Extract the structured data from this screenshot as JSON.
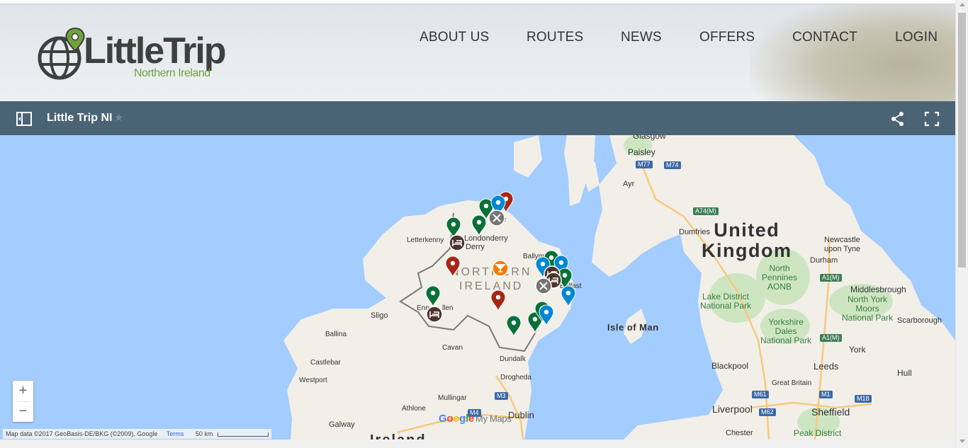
{
  "brand": {
    "name": "LittleTrip",
    "subtitle": "Northern Ireland"
  },
  "nav": {
    "items": [
      {
        "label": "ABOUT US"
      },
      {
        "label": "ROUTES"
      },
      {
        "label": "NEWS"
      },
      {
        "label": "OFFERS"
      },
      {
        "label": "CONTACT"
      },
      {
        "label": "LOGIN"
      }
    ]
  },
  "map_header": {
    "title": "Little Trip NI",
    "star_icon": "star-icon",
    "share_icon": "share-icon",
    "fullscreen_icon": "fullscreen-icon",
    "legend_icon": "legend-toggle-icon",
    "bar_color": "#4b6475"
  },
  "map": {
    "water_color": "#a3ccff",
    "land_color": "#f2efe9",
    "region_labels": {
      "uk_line1": "United",
      "uk_line2": "Kingdom",
      "ni_line1": "NORTHERN",
      "ni_line2": "IRELAND",
      "isle_of_man": "Isle of Man",
      "ireland": "Ireland"
    },
    "places": {
      "glasgow": "Glasgow",
      "paisley": "Paisley",
      "ayr": "Ayr",
      "dumfries": "Dumfries",
      "newcastle": "Newcastle",
      "upon_tyne": "upon Tyne",
      "durham": "Durham",
      "middlesbrough": "Middlesbrough",
      "north_pennines1": "North",
      "north_pennines2": "Pennines",
      "north_pennines3": "AONB",
      "lake_district1": "Lake District",
      "lake_district2": "National Park",
      "north_york1": "North York",
      "north_york2": "Moors",
      "north_york3": "National Park",
      "scarborough": "Scarborough",
      "yorkshire1": "Yorkshire",
      "yorkshire2": "Dales",
      "yorkshire3": "National Park",
      "york": "York",
      "blackpool": "Blackpool",
      "leeds": "Leeds",
      "hull": "Hull",
      "great_britain": "Great Britain",
      "liverpool": "Liverpool",
      "sheffield": "Sheffield",
      "chester": "Chester",
      "peak_district": "Peak District",
      "letterkenny": "Letterkenny",
      "londonderry": "Londonderry",
      "derry": "Derry",
      "ballymena": "Ballym",
      "belfast": "Belfast",
      "ballymoney": "ne",
      "enniskillen1": "Enn",
      "enniskillen2": "llen",
      "sligo": "Sligo",
      "ballina": "Ballina",
      "cavan": "Cavan",
      "dundalk": "Dundalk",
      "drogheda": "Drogheda",
      "castlebar": "Castlebar",
      "westport": "Westport",
      "mullingar": "Mullingar",
      "athlone": "Athlone",
      "galway": "Galway",
      "dublin": "Dublin"
    },
    "road_shields": [
      "M77",
      "M74",
      "A74(M)",
      "A1(M)",
      "A1(M)",
      "M61",
      "M62",
      "M1",
      "M18",
      "M3",
      "M4"
    ],
    "zoom_in": "+",
    "zoom_out": "−",
    "attribution": "Map data ©2017 GeoBasis-DE/BKG (©2009), Google",
    "terms": "Terms",
    "scale": "50 km",
    "google_logo": "Google",
    "my_maps": "My Maps",
    "marker_colors": {
      "green": "#097138",
      "blue": "#0288d1",
      "red": "#a52714",
      "orange": "#f57c00",
      "brown": "#4e342e",
      "grey": "#757575"
    }
  }
}
